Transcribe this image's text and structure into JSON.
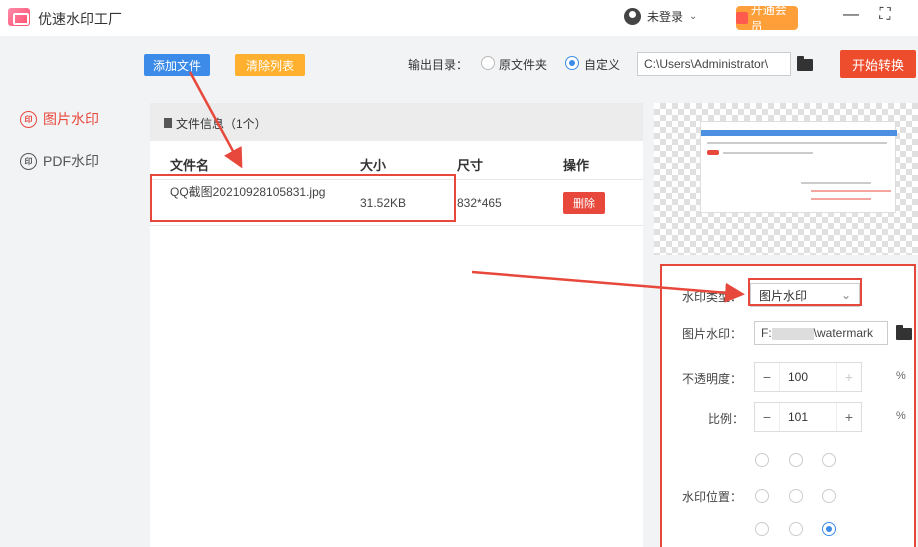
{
  "app": {
    "title": "优速水印工厂"
  },
  "header": {
    "user_label": "未登录",
    "vip_label": "开通会员",
    "minimize": "—",
    "maximize": "⛶"
  },
  "sidebar": {
    "items": [
      {
        "label": "图片水印"
      },
      {
        "label": "PDF水印"
      }
    ]
  },
  "toolbar": {
    "add_label": "添加文件",
    "clear_label": "清除列表",
    "output_label": "输出目录：",
    "radio_original": "原文件夹",
    "radio_custom": "自定义",
    "output_path": "C:\\Users\\Administrator\\",
    "start_label": "开始转换"
  },
  "file_panel": {
    "header": "文件信息（1个）",
    "columns": [
      "文件名",
      "大小",
      "尺寸",
      "操作"
    ],
    "rows": [
      {
        "name": "QQ截图20210928105831.jpg",
        "size": "31.52KB",
        "dims": "832*465",
        "action": "删除"
      }
    ]
  },
  "settings": {
    "type_label": "水印类型：",
    "type_value": "图片水印",
    "img_label": "图片水印：",
    "img_path_prefix": "F:",
    "img_path_suffix": "\\watermark",
    "opacity_label": "不透明度：",
    "opacity_value": "100",
    "scale_label": "比例：",
    "scale_value": "101",
    "percent": "%",
    "position_label": "水印位置：",
    "position_selected": "bottom-right"
  },
  "colors": {
    "accent_blue": "#3d8be8",
    "accent_red": "#e8483c",
    "accent_orange": "#ffb02e"
  }
}
